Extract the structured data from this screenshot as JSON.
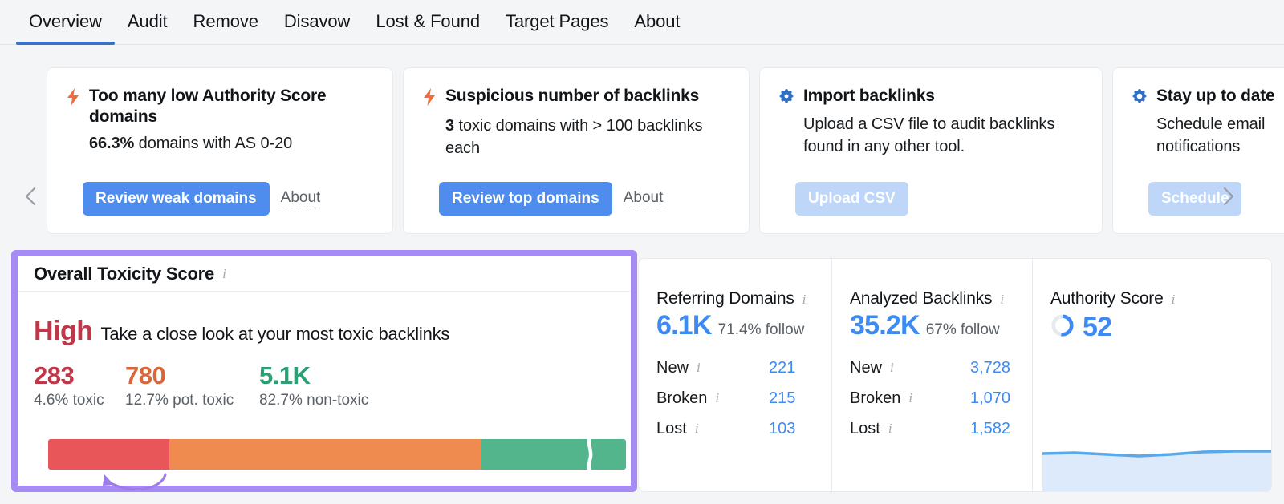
{
  "tabs": [
    {
      "label": "Overview",
      "active": true
    },
    {
      "label": "Audit",
      "active": false
    },
    {
      "label": "Remove",
      "active": false
    },
    {
      "label": "Disavow",
      "active": false
    },
    {
      "label": "Lost & Found",
      "active": false
    },
    {
      "label": "Target Pages",
      "active": false
    },
    {
      "label": "About",
      "active": false
    }
  ],
  "carousel": {
    "prev_icon": "chevron-left-icon",
    "next_icon": "chevron-right-icon",
    "cards": [
      {
        "icon": "bolt-icon",
        "title": "Too many low Authority Score domains",
        "desc_strong": "66.3%",
        "desc_rest": " domains with AS 0-20",
        "button": "Review weak domains",
        "button_state": "enabled",
        "link": "About"
      },
      {
        "icon": "bolt-icon",
        "title": "Suspicious number of backlinks",
        "desc_strong": "3",
        "desc_rest": " toxic domains with > 100 backlinks each",
        "button": "Review top domains",
        "button_state": "enabled",
        "link": "About"
      },
      {
        "icon": "gear-icon",
        "title": "Import backlinks",
        "desc_strong": "",
        "desc_rest": "Upload a CSV file to audit backlinks found in any other tool.",
        "button": "Upload CSV",
        "button_state": "disabled",
        "link": ""
      },
      {
        "icon": "gear-icon",
        "title": "Stay up to date",
        "desc_strong": "",
        "desc_rest": "Schedule email notifications",
        "button": "Schedule",
        "button_state": "disabled",
        "link": ""
      }
    ]
  },
  "toxicity": {
    "header": "Overall Toxicity Score",
    "info_icon": "info-icon",
    "level": "High",
    "level_color": "#c0374a",
    "message": "Take a close look at your most toxic backlinks",
    "highlight_color": "#a78bf5",
    "stats": [
      {
        "value": "283",
        "label": "4.6% toxic",
        "color": "#c0374a",
        "percent": 4.6
      },
      {
        "value": "780",
        "label": "12.7% pot. toxic",
        "color": "#d9653b",
        "percent": 12.7
      },
      {
        "value": "5.1K",
        "label": "82.7% non-toxic",
        "color": "#2e9e74",
        "percent": 82.7
      }
    ],
    "bar": {
      "segments": [
        {
          "name": "toxic",
          "percent": 21.0,
          "color": "#e8565a"
        },
        {
          "name": "pot-toxic",
          "percent": 54.0,
          "color": "#ef8b4e"
        },
        {
          "name": "non-toxic",
          "percent": 25.0,
          "color": "#52b58c"
        }
      ],
      "break_mark_icon": "axis-break-icon",
      "annotation_icon": "curved-arrow-icon"
    }
  },
  "metrics": {
    "columns": [
      {
        "title": "Referring Domains",
        "info_icon": "info-icon",
        "big": "6.1K",
        "sub": "71.4% follow",
        "rows": [
          {
            "name": "New",
            "value": "221"
          },
          {
            "name": "Broken",
            "value": "215"
          },
          {
            "name": "Lost",
            "value": "103"
          }
        ]
      },
      {
        "title": "Analyzed Backlinks",
        "info_icon": "info-icon",
        "big": "35.2K",
        "sub": "67% follow",
        "rows": [
          {
            "name": "New",
            "value": "3,728"
          },
          {
            "name": "Broken",
            "value": "1,070"
          },
          {
            "name": "Lost",
            "value": "1,582"
          }
        ]
      },
      {
        "title": "Authority Score",
        "info_icon": "info-icon",
        "score": "52",
        "donut_icon": "donut-progress-icon",
        "donut_percent": 52,
        "sparkline_icon": "area-sparkline"
      }
    ]
  },
  "colors": {
    "accent_blue": "#3d8bf2",
    "button_blue": "#4e8ced",
    "tab_underline": "#3b70c4",
    "purple_highlight": "#a78bf5",
    "bolt_orange": "#ef6c3c",
    "gear_blue": "#2f6fc4"
  }
}
